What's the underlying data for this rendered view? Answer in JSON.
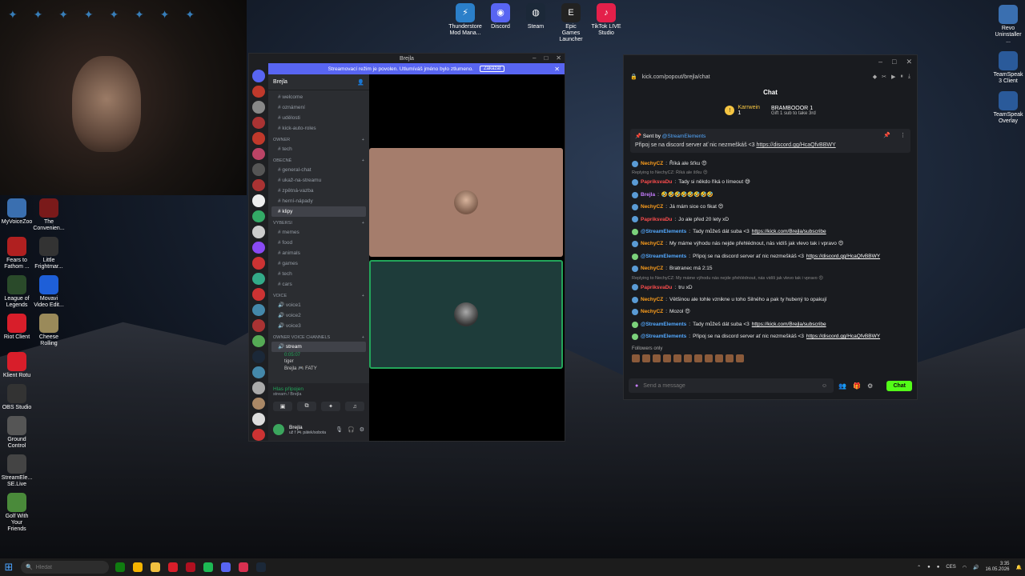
{
  "desktop": {
    "top_icons": [
      {
        "label": "Thunderstore Mod Mana...",
        "color": "#2b7fc9",
        "glyph": "⚡"
      },
      {
        "label": "Discord",
        "color": "#5865f2",
        "glyph": "◉"
      },
      {
        "label": "Steam",
        "color": "#1b2838",
        "glyph": "◍"
      },
      {
        "label": "Epic Games Launcher",
        "color": "#222222",
        "glyph": "E"
      },
      {
        "label": "TikTok LIVE Studio",
        "color": "#e4204a",
        "glyph": "♪"
      }
    ],
    "left_icons": [
      {
        "label": "MyVoiceZoo",
        "color": "#3a6fb0"
      },
      {
        "label": "The Convenien...",
        "color": "#7a1a1a"
      },
      {
        "label": "Fears to Fathom ...",
        "color": "#b02020"
      },
      {
        "label": "Little Frightmar...",
        "color": "#333333"
      },
      {
        "label": "League of Legends",
        "color": "#2a4a2a"
      },
      {
        "label": "Movavi Video Edit...",
        "color": "#1e5fd8"
      },
      {
        "label": "Riot Client",
        "color": "#d81e2a"
      },
      {
        "label": "Cheese Rolling",
        "color": "#9a8a5a"
      },
      {
        "label": "Klient Rotu",
        "color": "#d81e2a"
      },
      {
        "label": "",
        "color": "transparent"
      },
      {
        "label": "OBS Studio",
        "color": "#333333"
      },
      {
        "label": "",
        "color": "transparent"
      },
      {
        "label": "Ground Control",
        "color": "#555555"
      },
      {
        "label": "",
        "color": "transparent"
      },
      {
        "label": "StreamEle... SE.Live",
        "color": "#444444"
      },
      {
        "label": "",
        "color": "transparent"
      },
      {
        "label": "Golf With Your Friends",
        "color": "#4a8a3a"
      }
    ],
    "right_icons": [
      {
        "label": "Revo Uninstaller ...",
        "color": "#3a6fb0"
      },
      {
        "label": "TeamSpeak 3 Client",
        "color": "#2a5a9a"
      },
      {
        "label": "TeamSpeak Overlay",
        "color": "#2a5a9a"
      }
    ]
  },
  "discord": {
    "title": "Brejla",
    "banner_text": "Streamovací režim je povolen. Utlumíváš jméno bylo ztlumeno.",
    "banner_button": "Zakázat",
    "server_name": "Brejla",
    "channels": [
      {
        "type": "ch",
        "label": "# welcome"
      },
      {
        "type": "ch",
        "label": "# oznámení"
      },
      {
        "type": "ch",
        "label": "# udělosti"
      },
      {
        "type": "ch",
        "label": "# kick-auto-roles"
      },
      {
        "type": "cat",
        "label": "OWNER"
      },
      {
        "type": "ch",
        "label": "# tech"
      },
      {
        "type": "cat",
        "label": "OBECNÉ"
      },
      {
        "type": "ch",
        "label": "# general-chat"
      },
      {
        "type": "ch",
        "label": "# ukaž-na-streamu"
      },
      {
        "type": "ch",
        "label": "# zpětná-vazba"
      },
      {
        "type": "ch",
        "label": "# herní-nápady"
      },
      {
        "type": "ch",
        "label": "# klipy",
        "active": true
      },
      {
        "type": "cat",
        "label": "VYBERSI"
      },
      {
        "type": "ch",
        "label": "# memes"
      },
      {
        "type": "ch",
        "label": "# food"
      },
      {
        "type": "ch",
        "label": "# animals"
      },
      {
        "type": "ch",
        "label": "# games"
      },
      {
        "type": "ch",
        "label": "# tech"
      },
      {
        "type": "ch",
        "label": "# cars"
      },
      {
        "type": "cat",
        "label": "VOICE"
      },
      {
        "type": "ch",
        "label": "🔊 voice1"
      },
      {
        "type": "ch",
        "label": "🔊 voice2"
      },
      {
        "type": "ch",
        "label": "🔊 voice3"
      },
      {
        "type": "cat",
        "label": "OWNER VOICE CHANNELS"
      },
      {
        "type": "ch",
        "label": "🔊 stream",
        "active": true
      }
    ],
    "voice_users": [
      "tiger",
      "Brejla 🎮 FATY"
    ],
    "voice_timer": "0:05:07",
    "voice_status": "Hlas připojen",
    "voice_channel_path": "stream / Brejla",
    "user_name": "Brejla",
    "user_status": "už ř 🎮 pátek/sobota"
  },
  "kick": {
    "url": "kick.com/popout/brejla/chat",
    "header": "Chat",
    "gifter": {
      "name": "Karrwein",
      "count": "1",
      "target": "BRAMBOOOR",
      "target_count": "1",
      "sub_text": "Gift 1 sub to take 3rd"
    },
    "pinned": {
      "by_label": "Sent by",
      "by_user": "@StreamElements",
      "text": "Připoj se na discord server ať nic nezmeškáš <3",
      "link": "https://discord.gg/HcaQfvBBWY"
    },
    "messages": [
      {
        "user": "NechyCZ",
        "color": "#ff9f1c",
        "text": "Říká ale šťku 😍"
      },
      {
        "reply": "Replying to NechyCZ: Říká ale šťku 😍"
      },
      {
        "user": "PapriksvaDu",
        "color": "#ff4d4d",
        "text": "Tady si někdo říká o límeout 😅"
      },
      {
        "user": "Brejla",
        "color": "#c77dff",
        "text": "🤣🤣🤣🤣🤣🤣🤣🤣"
      },
      {
        "user": "NechyCZ",
        "color": "#ff9f1c",
        "text": "Já mám sice co fikat 😍"
      },
      {
        "user": "PapriksvaDu",
        "color": "#ff4d4d",
        "text": "Jo ale před 20 lety xD"
      },
      {
        "user": "@StreamElements",
        "color": "#53a9ff",
        "text": "Tady můžeš dát suba <3",
        "link": "https://kick.com/Brejla/subscribe"
      },
      {
        "user": "NechyCZ",
        "color": "#ff9f1c",
        "text": "My máme výhodu nás nejde přehlédnout, nás vidíš jak vlevo tak i vpravo 😍"
      },
      {
        "user": "@StreamElements",
        "color": "#53a9ff",
        "text": "Připoj se na discord server ať nic nezmeškáš <3",
        "link": "https://discord.gg/HcaQfvBBWY"
      },
      {
        "user": "NechyCZ",
        "color": "#ff9f1c",
        "text": "Bratranec má 2:15"
      },
      {
        "reply": "Replying to NechyCZ: My máme výhodu nás nejde přehlédnout, nás vidíš jak vlevo tak i vpravo 😍"
      },
      {
        "user": "PapriksvaDu",
        "color": "#ff4d4d",
        "text": "tru xD"
      },
      {
        "user": "NechyCZ",
        "color": "#ff9f1c",
        "text": "Většinou ale tohle vznikne u toho Silného a pak ty hubený to opakují"
      },
      {
        "user": "NechyCZ",
        "color": "#ff9f1c",
        "text": "Mozol 😍"
      },
      {
        "user": "@StreamElements",
        "color": "#53a9ff",
        "text": "Tady můžeš dát suba <3",
        "link": "https://kick.com/Brejla/subscribe"
      },
      {
        "user": "@StreamElements",
        "color": "#53a9ff",
        "text": "Připoj se na discord server ať nic nezmeškáš <3",
        "link": "https://discord.gg/HcaQfvBBWY"
      }
    ],
    "followers_only": "Followers only",
    "input_placeholder": "Send a message",
    "send_label": "Chat"
  },
  "taskbar": {
    "search_placeholder": "Hledat",
    "tray_lang": "CES",
    "time": "3:35",
    "date": "16.05.2026"
  }
}
